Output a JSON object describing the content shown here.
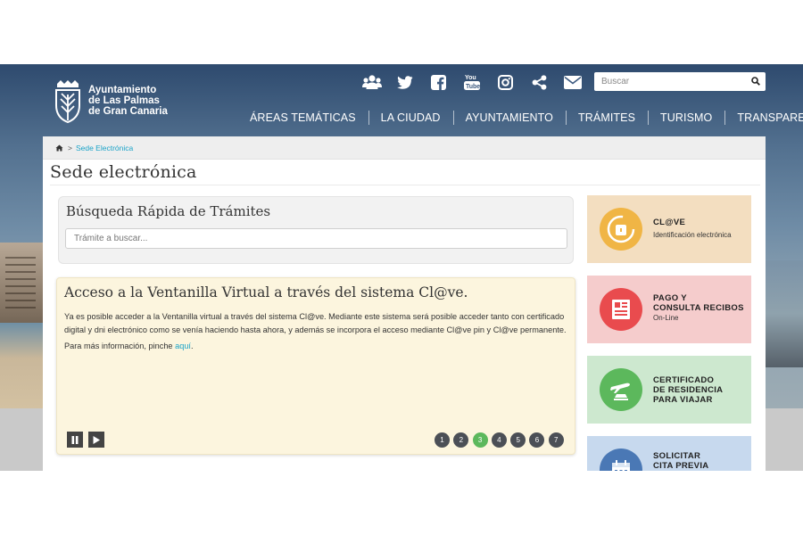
{
  "header": {
    "logo_text": [
      "Ayuntamiento",
      "de Las Palmas",
      "de Gran Canaria"
    ],
    "social_icons": [
      "users-icon",
      "twitter-icon",
      "facebook-icon",
      "youtube-icon",
      "instagram-icon",
      "share-icon",
      "mail-icon"
    ],
    "search_placeholder": "Buscar",
    "nav": [
      "ÁREAS TEMÁTICAS",
      "LA CIUDAD",
      "AYUNTAMIENTO",
      "TRÁMITES",
      "TURISMO",
      "TRANSPARENCIA"
    ]
  },
  "breadcrumb": {
    "home_icon": "home-icon",
    "separator": ">",
    "current": "Sede Electrónica"
  },
  "page_title": "Sede electrónica",
  "quick_search": {
    "title": "Búsqueda Rápida de Trámites",
    "placeholder": "Trámite a buscar..."
  },
  "slide": {
    "title": "Acceso a la Ventanilla Virtual a través del sistema Cl@ve.",
    "paragraph": "Ya es posible acceder a la Ventanilla virtual a través del sistema Cl@ve. Mediante este sistema será posible acceder tanto con certificado digital y dni electrónico como se venía haciendo hasta ahora, y además se incorpora el acceso mediante Cl@ve pin y Cl@ve permanente.",
    "more_prefix": "Para más información, pinche ",
    "more_link": "aquí",
    "more_suffix": ".",
    "pages": [
      "1",
      "2",
      "3",
      "4",
      "5",
      "6",
      "7"
    ],
    "active_page": "3"
  },
  "cards": [
    {
      "title": "CL@VE",
      "subtitle": "Identificación electrónica",
      "bg": "#f3dec0",
      "circle": "#f0b545",
      "icon": "clave-icon"
    },
    {
      "title_lines": [
        "PAGO Y",
        "CONSULTA RECIBOS"
      ],
      "subtitle": "On-Line",
      "bg": "#f5cccc",
      "circle": "#e94b4e",
      "icon": "receipt-icon"
    },
    {
      "title_lines": [
        "CERTIFICADO",
        "DE RESIDENCIA",
        "PARA VIAJAR"
      ],
      "bg": "#cde8cf",
      "circle": "#5cb85c",
      "icon": "travel-icon"
    },
    {
      "title_lines": [
        "SOLICITAR",
        "CITA PREVIA"
      ],
      "bg": "#c7d9ee",
      "circle": "#4a78b5",
      "icon": "calendar-icon"
    }
  ],
  "colors": {
    "link": "#1aa3c8",
    "active_dot": "#5cb85c",
    "slide_bg": "#fcf5de"
  }
}
